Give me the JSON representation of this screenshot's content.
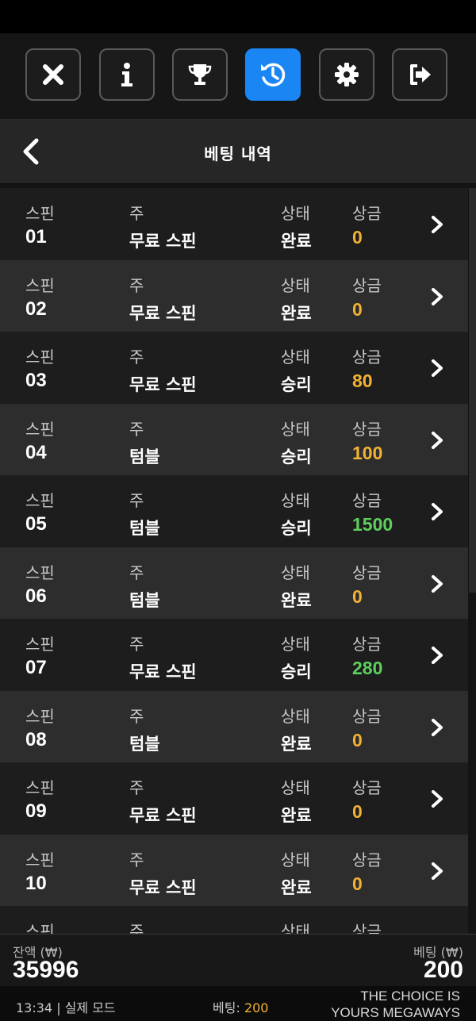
{
  "toolbar": {
    "buttons": [
      {
        "icon": "close-icon",
        "active": false
      },
      {
        "icon": "info-icon",
        "active": false
      },
      {
        "icon": "trophy-icon",
        "active": false
      },
      {
        "icon": "history-icon",
        "active": true
      },
      {
        "icon": "gear-icon",
        "active": false
      },
      {
        "icon": "exit-icon",
        "active": false
      }
    ]
  },
  "header": {
    "title": "베팅 내역"
  },
  "labels": {
    "spin": "스핀",
    "bet": "주",
    "status": "상태",
    "prize": "상금"
  },
  "colors": {
    "accent": "#1a86f3",
    "prize_default": "#f2b233",
    "prize_big": "#5ccf5c"
  },
  "rows": [
    {
      "spin": "01",
      "bet": "무료 스핀",
      "status": "완료",
      "prize": "0",
      "prize_color": "#f2b233"
    },
    {
      "spin": "02",
      "bet": "무료 스핀",
      "status": "완료",
      "prize": "0",
      "prize_color": "#f2b233"
    },
    {
      "spin": "03",
      "bet": "무료 스핀",
      "status": "승리",
      "prize": "80",
      "prize_color": "#f2b233"
    },
    {
      "spin": "04",
      "bet": "텀블",
      "status": "승리",
      "prize": "100",
      "prize_color": "#f2b233"
    },
    {
      "spin": "05",
      "bet": "텀블",
      "status": "승리",
      "prize": "1500",
      "prize_color": "#5ccf5c"
    },
    {
      "spin": "06",
      "bet": "텀블",
      "status": "완료",
      "prize": "0",
      "prize_color": "#f2b233"
    },
    {
      "spin": "07",
      "bet": "무료 스핀",
      "status": "승리",
      "prize": "280",
      "prize_color": "#5ccf5c"
    },
    {
      "spin": "08",
      "bet": "텀블",
      "status": "완료",
      "prize": "0",
      "prize_color": "#f2b233"
    },
    {
      "spin": "09",
      "bet": "무료 스핀",
      "status": "완료",
      "prize": "0",
      "prize_color": "#f2b233"
    },
    {
      "spin": "10",
      "bet": "무료 스핀",
      "status": "완료",
      "prize": "0",
      "prize_color": "#f2b233"
    },
    {
      "spin": "",
      "bet": "",
      "status": "",
      "prize": "",
      "prize_color": "#f2b233"
    }
  ],
  "footer": {
    "balance_label": "잔액 (₩)",
    "balance_value": "35996",
    "bet_label": "베팅 (₩)",
    "bet_value": "200"
  },
  "statusbar": {
    "time": "13:34",
    "mode": "| 실제 모드",
    "bet_label": "베팅:",
    "bet_value": "200",
    "game_line1": "THE CHOICE IS",
    "game_line2": "YOURS MEGAWAYS"
  }
}
